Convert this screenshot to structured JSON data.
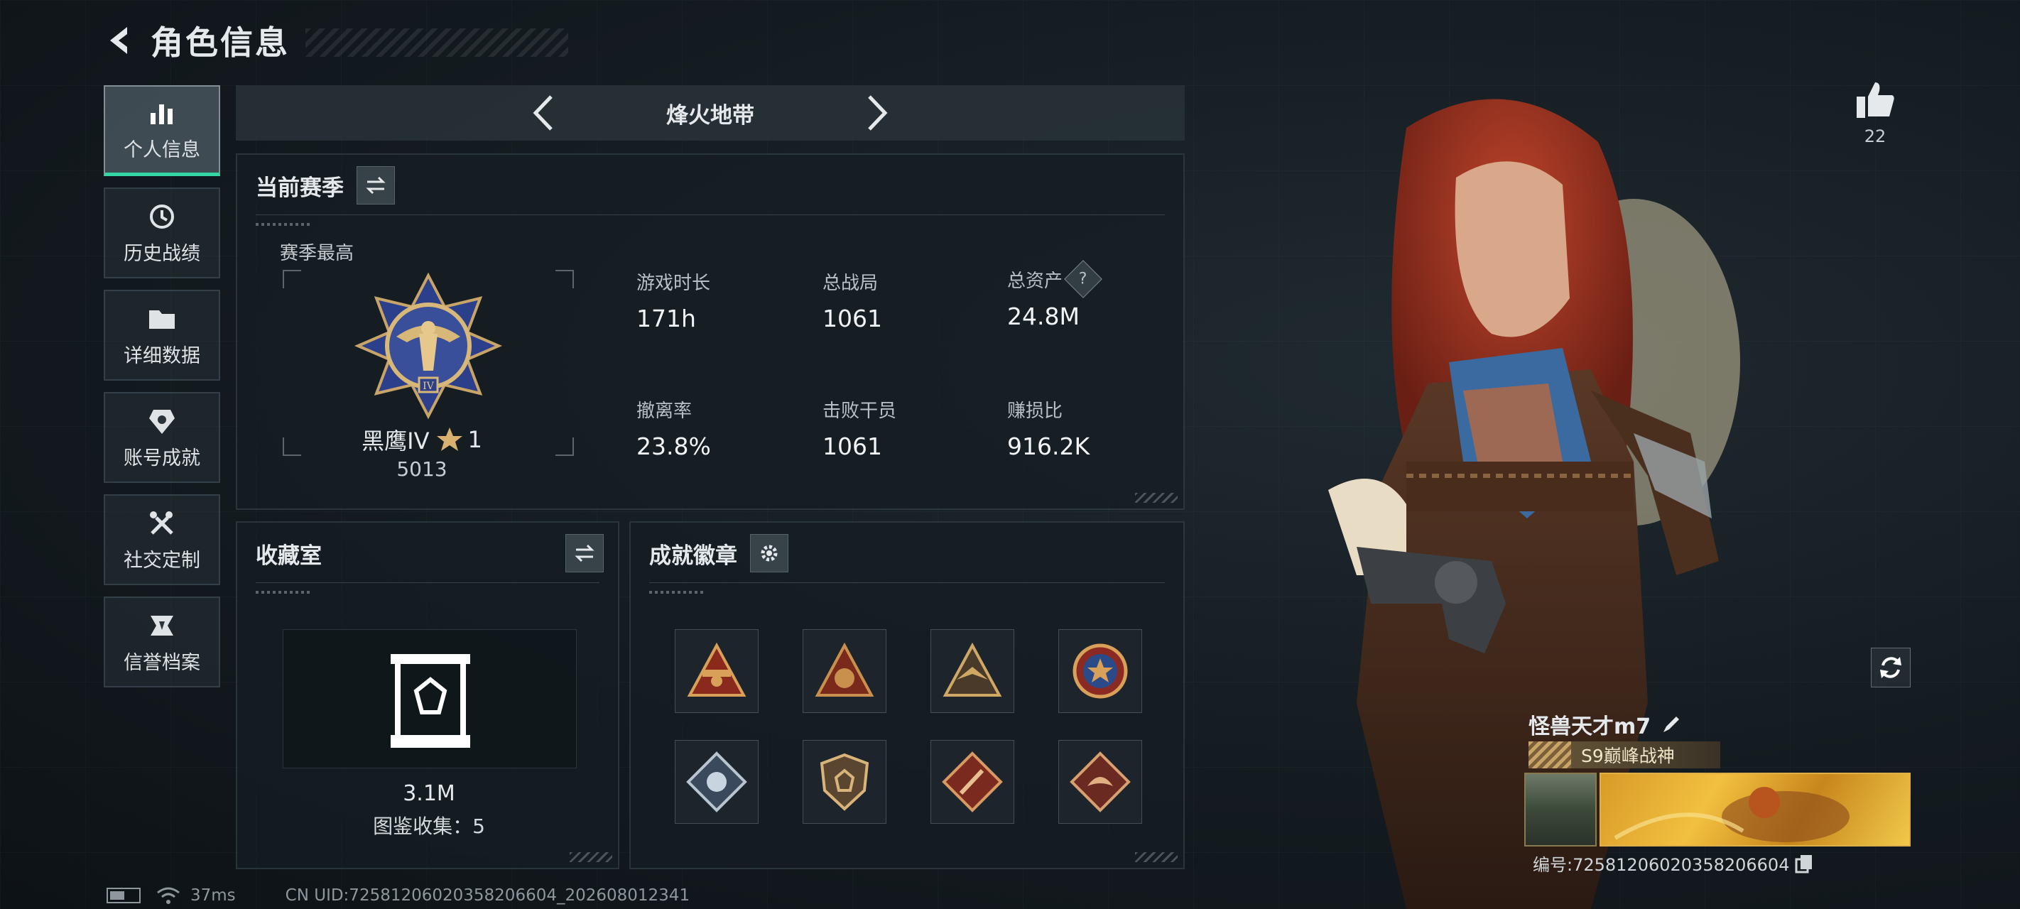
{
  "header": {
    "title": "角色信息"
  },
  "nav": [
    {
      "id": "personal",
      "label": "个人信息",
      "icon": "bar-chart-icon",
      "active": true
    },
    {
      "id": "history",
      "label": "历史战绩",
      "icon": "history-icon",
      "active": false
    },
    {
      "id": "details",
      "label": "详细数据",
      "icon": "folder-icon",
      "active": false
    },
    {
      "id": "achievements",
      "label": "账号成就",
      "icon": "achievement-icon",
      "active": false
    },
    {
      "id": "social",
      "label": "社交定制",
      "icon": "tools-icon",
      "active": false
    },
    {
      "id": "credit",
      "label": "信誉档案",
      "icon": "credit-icon",
      "active": false
    }
  ],
  "mode": {
    "title": "烽火地带"
  },
  "season": {
    "title": "当前赛季",
    "best_label": "赛季最高",
    "rank_name": "黑鹰IV",
    "rank_stars": "1",
    "rank_score": "5013",
    "stats": [
      {
        "label": "游戏时长",
        "value": "171h"
      },
      {
        "label": "总战局",
        "value": "1061"
      },
      {
        "label": "总资产",
        "value": "24.8M",
        "help": "?"
      },
      {
        "label": "撤离率",
        "value": "23.8%"
      },
      {
        "label": "击败干员",
        "value": "1061"
      },
      {
        "label": "赚损比",
        "value": "916.2K"
      }
    ]
  },
  "collection": {
    "title": "收藏室",
    "value": "3.1M",
    "count_text": "图鉴收集：5"
  },
  "badges": {
    "title": "成就徽章",
    "items": [
      "badge-1",
      "badge-2",
      "badge-3",
      "badge-4",
      "badge-5",
      "badge-6",
      "badge-7",
      "badge-8"
    ]
  },
  "player": {
    "likes": "22",
    "name": "怪兽天才m7",
    "title_badge": "S9巅峰战神",
    "id_text": "编号:7258120602035820660​4"
  },
  "footer": {
    "ping": "37ms",
    "uid": "CN UID:7258120602035820​6604_202608012341"
  },
  "colors": {
    "accent": "#35d6a5",
    "gold": "#c8a468"
  }
}
